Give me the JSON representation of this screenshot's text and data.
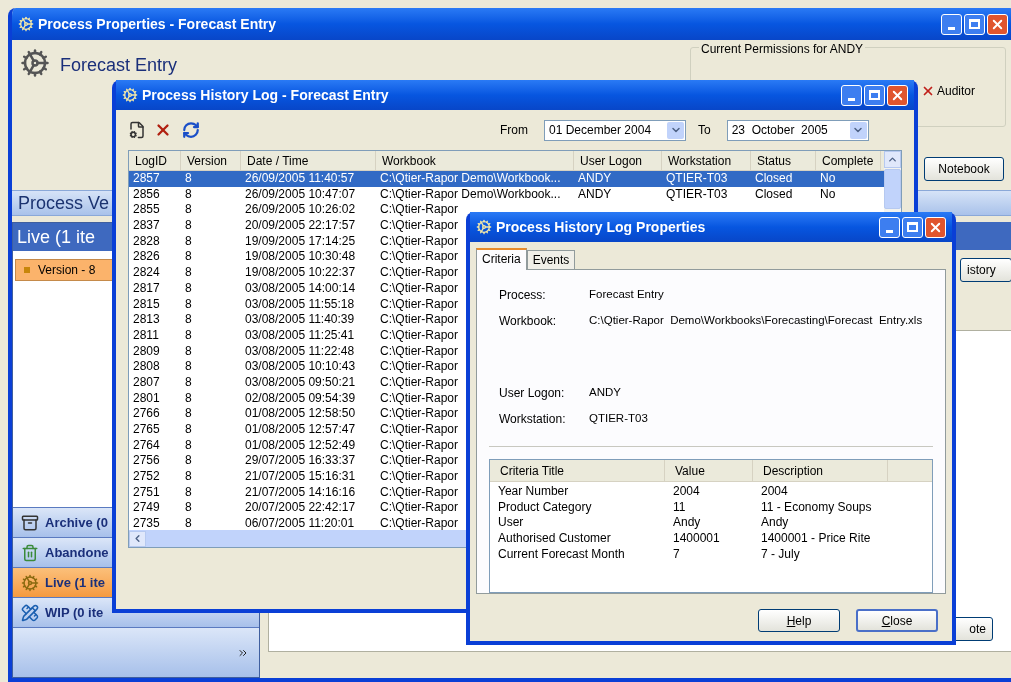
{
  "main_window": {
    "title": "Process Properties - Forecast Entry",
    "heading": "Forecast Entry",
    "permissions": {
      "title": "Current Permissions for ANDY",
      "items": [
        {
          "label": "Auditor",
          "granted": false
        }
      ]
    },
    "notebook_button": "Notebook",
    "versions_bar": "Process Ve",
    "panel": {
      "title": "Live  (1 ite",
      "items": [
        {
          "label": "Version - 8",
          "selected": true
        }
      ]
    },
    "nav": [
      {
        "label": "Archive  (0",
        "kind": "archive",
        "selected": false
      },
      {
        "label": "Abandone",
        "kind": "bin",
        "selected": false
      },
      {
        "label": "Live  (1 ite",
        "kind": "live",
        "selected": true
      },
      {
        "label": "WIP  (0 ite",
        "kind": "wip",
        "selected": false
      }
    ],
    "history_button": "istory",
    "note_button": "ote"
  },
  "history_window": {
    "title": "Process History Log - Forecast Entry",
    "from_label": "From",
    "from_date": "01 December 2004",
    "to_label": "To",
    "to_date": "23  October  2005",
    "columns": [
      "LogID",
      "Version",
      "Date / Time",
      "Workbook",
      "User Logon",
      "Workstation",
      "Status",
      "Complete"
    ],
    "rows": [
      {
        "cells": [
          "2857",
          "8",
          "26/09/2005 11:40:57",
          "C:\\Qtier-Rapor Demo\\Workbook...",
          "ANDY",
          "QTIER-T03",
          "Closed",
          "No"
        ],
        "selected": true
      },
      {
        "cells": [
          "2856",
          "8",
          "26/09/2005 10:47:07",
          "C:\\Qtier-Rapor Demo\\Workbook...",
          "ANDY",
          "QTIER-T03",
          "Closed",
          "No"
        ],
        "selected": false
      },
      {
        "cells": [
          "2855",
          "8",
          "26/09/2005 10:26:02",
          "C:\\Qtier-Rapor"
        ],
        "selected": false
      },
      {
        "cells": [
          "2837",
          "8",
          "20/09/2005 22:17:57",
          "C:\\Qtier-Rapor"
        ],
        "selected": false
      },
      {
        "cells": [
          "2828",
          "8",
          "19/09/2005 17:14:25",
          "C:\\Qtier-Rapor"
        ],
        "selected": false
      },
      {
        "cells": [
          "2826",
          "8",
          "19/08/2005 10:30:48",
          "C:\\Qtier-Rapor"
        ],
        "selected": false
      },
      {
        "cells": [
          "2824",
          "8",
          "19/08/2005 10:22:37",
          "C:\\Qtier-Rapor"
        ],
        "selected": false
      },
      {
        "cells": [
          "2817",
          "8",
          "03/08/2005 14:00:14",
          "C:\\Qtier-Rapor"
        ],
        "selected": false
      },
      {
        "cells": [
          "2815",
          "8",
          "03/08/2005 11:55:18",
          "C:\\Qtier-Rapor"
        ],
        "selected": false
      },
      {
        "cells": [
          "2813",
          "8",
          "03/08/2005 11:40:39",
          "C:\\Qtier-Rapor"
        ],
        "selected": false
      },
      {
        "cells": [
          "2811",
          "8",
          "03/08/2005 11:25:41",
          "C:\\Qtier-Rapor"
        ],
        "selected": false
      },
      {
        "cells": [
          "2809",
          "8",
          "03/08/2005 11:22:48",
          "C:\\Qtier-Rapor"
        ],
        "selected": false
      },
      {
        "cells": [
          "2808",
          "8",
          "03/08/2005 10:10:43",
          "C:\\Qtier-Rapor"
        ],
        "selected": false
      },
      {
        "cells": [
          "2807",
          "8",
          "03/08/2005 09:50:21",
          "C:\\Qtier-Rapor"
        ],
        "selected": false
      },
      {
        "cells": [
          "2801",
          "8",
          "02/08/2005 09:54:39",
          "C:\\Qtier-Rapor"
        ],
        "selected": false
      },
      {
        "cells": [
          "2766",
          "8",
          "01/08/2005 12:58:50",
          "C:\\Qtier-Rapor"
        ],
        "selected": false
      },
      {
        "cells": [
          "2765",
          "8",
          "01/08/2005 12:57:47",
          "C:\\Qtier-Rapor"
        ],
        "selected": false
      },
      {
        "cells": [
          "2764",
          "8",
          "01/08/2005 12:52:49",
          "C:\\Qtier-Rapor"
        ],
        "selected": false
      },
      {
        "cells": [
          "2756",
          "8",
          "29/07/2005 16:33:37",
          "C:\\Qtier-Rapor"
        ],
        "selected": false
      },
      {
        "cells": [
          "2752",
          "8",
          "21/07/2005 15:16:31",
          "C:\\Qtier-Rapor"
        ],
        "selected": false
      },
      {
        "cells": [
          "2751",
          "8",
          "21/07/2005 14:16:16",
          "C:\\Qtier-Rapor"
        ],
        "selected": false
      },
      {
        "cells": [
          "2749",
          "8",
          "20/07/2005 22:42:17",
          "C:\\Qtier-Rapor"
        ],
        "selected": false
      },
      {
        "cells": [
          "2735",
          "8",
          "06/07/2005 11:20:01",
          "C:\\Qtier-Rapor"
        ],
        "selected": false
      }
    ]
  },
  "properties_window": {
    "title": "Process History Log Properties",
    "tabs": [
      {
        "label": "Criteria",
        "selected": true
      },
      {
        "label": "Events",
        "selected": false
      }
    ],
    "fields": [
      {
        "label": "Process:",
        "value": "Forecast Entry"
      },
      {
        "label": "Workbook:",
        "value": "C:\\Qtier-Rapor  Demo\\Workbooks\\Forecasting\\Forecast  Entry.xls"
      },
      {
        "label": "User Logon:",
        "value": "ANDY"
      },
      {
        "label": "Workstation:",
        "value": "QTIER-T03"
      }
    ],
    "criteria": {
      "columns": [
        "Criteria Title",
        "Value",
        "Description"
      ],
      "rows": [
        [
          "Year Number",
          "2004",
          "2004"
        ],
        [
          "Product Category",
          "11",
          "11 - Economy Soups"
        ],
        [
          "User",
          "Andy",
          "Andy"
        ],
        [
          "Authorised Customer",
          "1400001",
          "1400001 - Price Rite"
        ],
        [
          "Current Forecast Month",
          "7",
          "7 - July"
        ]
      ]
    },
    "buttons": [
      {
        "label": "Help",
        "focused": false
      },
      {
        "label": "Close",
        "focused": true
      }
    ]
  }
}
